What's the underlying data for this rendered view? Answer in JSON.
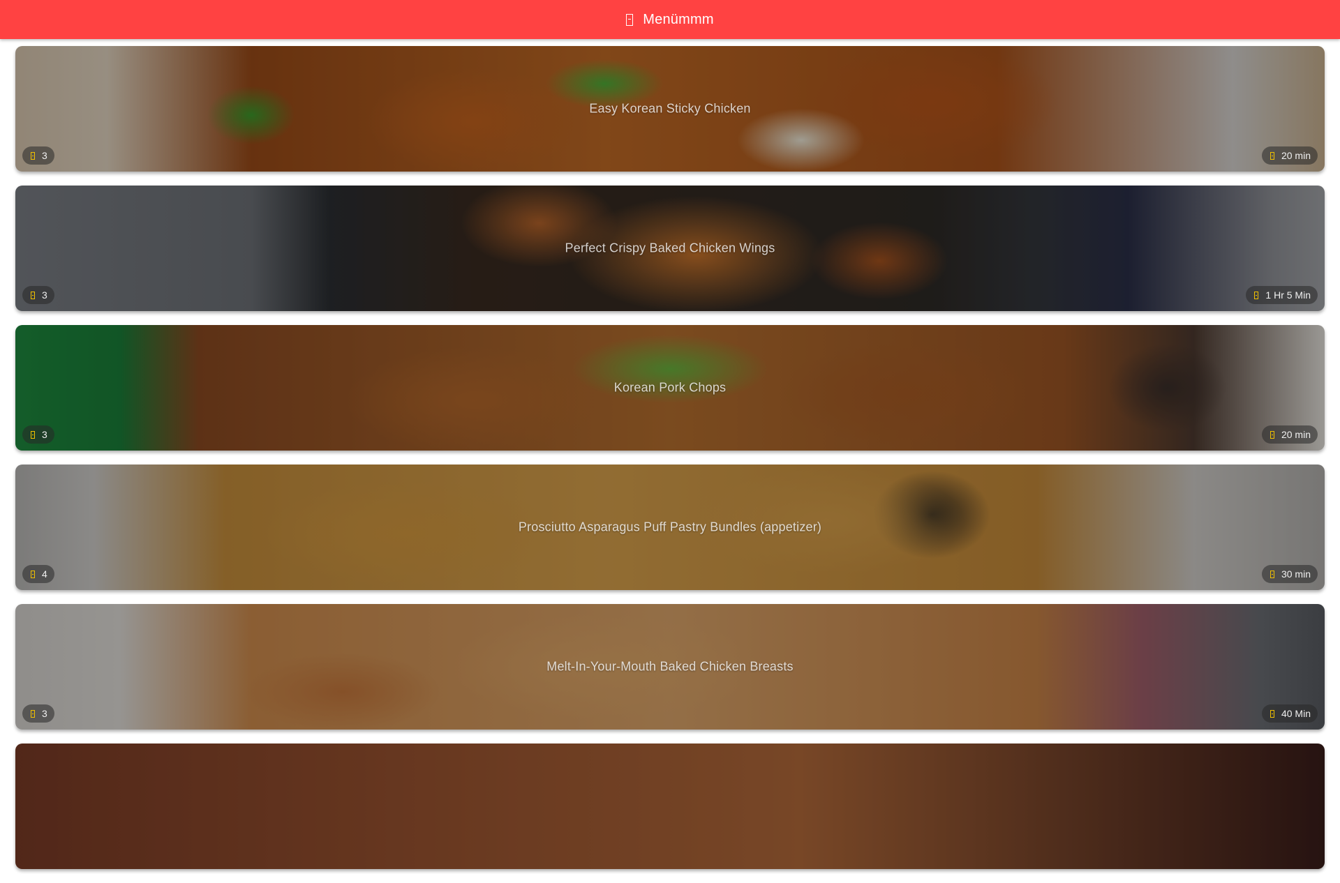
{
  "appbar": {
    "icon": "menu-book-icon",
    "title": "Menümmm",
    "color": "#ff4242"
  },
  "recipes": [
    {
      "name": "Easy Korean Sticky Chicken",
      "servings": "3",
      "time": "20 min"
    },
    {
      "name": "Perfect Crispy Baked Chicken Wings",
      "servings": "3",
      "time": "1 Hr 5 Min"
    },
    {
      "name": "Korean Pork Chops",
      "servings": "3",
      "time": "20 min"
    },
    {
      "name": "Prosciutto Asparagus Puff Pastry Bundles (appetizer)",
      "servings": "4",
      "time": "30 min"
    },
    {
      "name": "Melt-In-Your-Mouth Baked Chicken Breasts",
      "servings": "3",
      "time": "40 Min"
    }
  ],
  "chip_icons": {
    "servings": "servings-icon",
    "time": "timer-icon"
  },
  "chip_icon_color": "#f2c200"
}
